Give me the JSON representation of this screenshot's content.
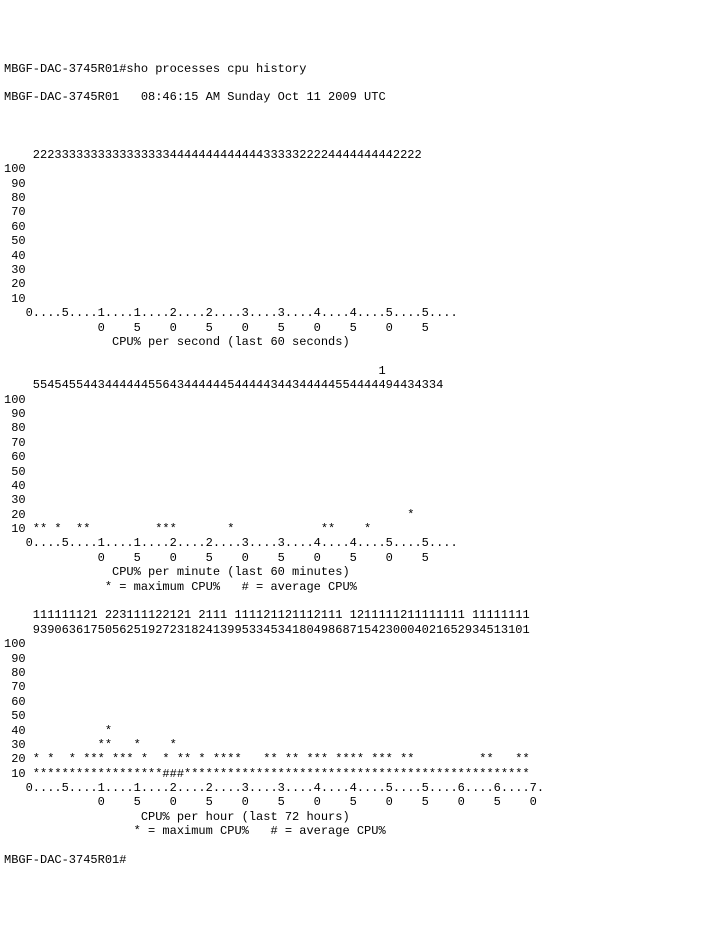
{
  "prompt1": "MBGF-DAC-3745R01#",
  "command": "sho processes cpu history",
  "header_line": "MBGF-DAC-3745R01   08:46:15 AM Sunday Oct 11 2009 UTC",
  "prompt2": "MBGF-DAC-3745R01#",
  "chart_data": [
    {
      "type": "line",
      "title": "CPU% per second (last 60 seconds)",
      "xlabel": "seconds",
      "ylabel": "CPU%",
      "ylim": [
        0,
        100
      ],
      "categories": [
        "0",
        "5",
        "10",
        "15",
        "20",
        "25",
        "30",
        "35",
        "40",
        "45",
        "50",
        "55"
      ],
      "values_header": "    222333333333333333344444444444443333322224444444442222",
      "y_axis_labels": [
        "100",
        " 90",
        " 80",
        " 70",
        " 60",
        " 50",
        " 40",
        " 30",
        " 20",
        " 10"
      ],
      "x_ruler": "   0....5....1....1....2....2....3....3....4....4....5....5....",
      "x_ruler2": "             0    5    0    5    0    5    0    5    0    5",
      "caption": "               CPU% per second (last 60 seconds)"
    },
    {
      "type": "line",
      "title": "CPU% per minute (last 60 minutes)",
      "legend": "* = maximum CPU%   # = average CPU%",
      "xlabel": "minutes",
      "ylabel": "CPU%",
      "ylim": [
        0,
        100
      ],
      "values_header1": "                                                    1",
      "values_header2": "    554545544344444455643444444544444344344444554444494434334",
      "y_axis_labels": [
        "100",
        " 90",
        " 80",
        " 70",
        " 60",
        " 50",
        " 40",
        " 30",
        " 20",
        " 10"
      ],
      "row_20": " 20                                                     *",
      "row_10": " 10 ** *  **         ***       *            **    *",
      "x_ruler": "   0....5....1....1....2....2....3....3....4....4....5....5....",
      "x_ruler2": "             0    5    0    5    0    5    0    5    0    5",
      "caption1": "               CPU% per minute (last 60 minutes)",
      "caption2": "              * = maximum CPU%   # = average CPU%"
    },
    {
      "type": "line",
      "title": "CPU% per hour (last 72 hours)",
      "legend": "* = maximum CPU%   # = average CPU%",
      "xlabel": "hours",
      "ylabel": "CPU%",
      "ylim": [
        0,
        100
      ],
      "values_header1": "    111111121 223111122121 2111 111121121112111 1211111211111111 11111111",
      "values_header2": "    939063617505625192723182413995334534180498687154230004021652934513101",
      "y_axis_labels": [
        "100",
        " 90",
        " 80",
        " 70",
        " 60",
        " 50",
        " 40",
        " 30",
        " 20",
        " 10"
      ],
      "row_40": " 40           *",
      "row_30": " 30          **   *    *",
      "row_20": " 20 * *  * *** *** *  * ** * ****   ** ** *** **** *** **         **   **",
      "row_10": " 10 ******************###************************************************",
      "x_ruler": "   0....5....1....1....2....2....3....3....4....4....5....5....6....6....7.",
      "x_ruler2": "             0    5    0    5    0    5    0    5    0    5    0    5    0",
      "caption1": "                   CPU% per hour (last 72 hours)",
      "caption2": "                  * = maximum CPU%   # = average CPU%"
    }
  ]
}
